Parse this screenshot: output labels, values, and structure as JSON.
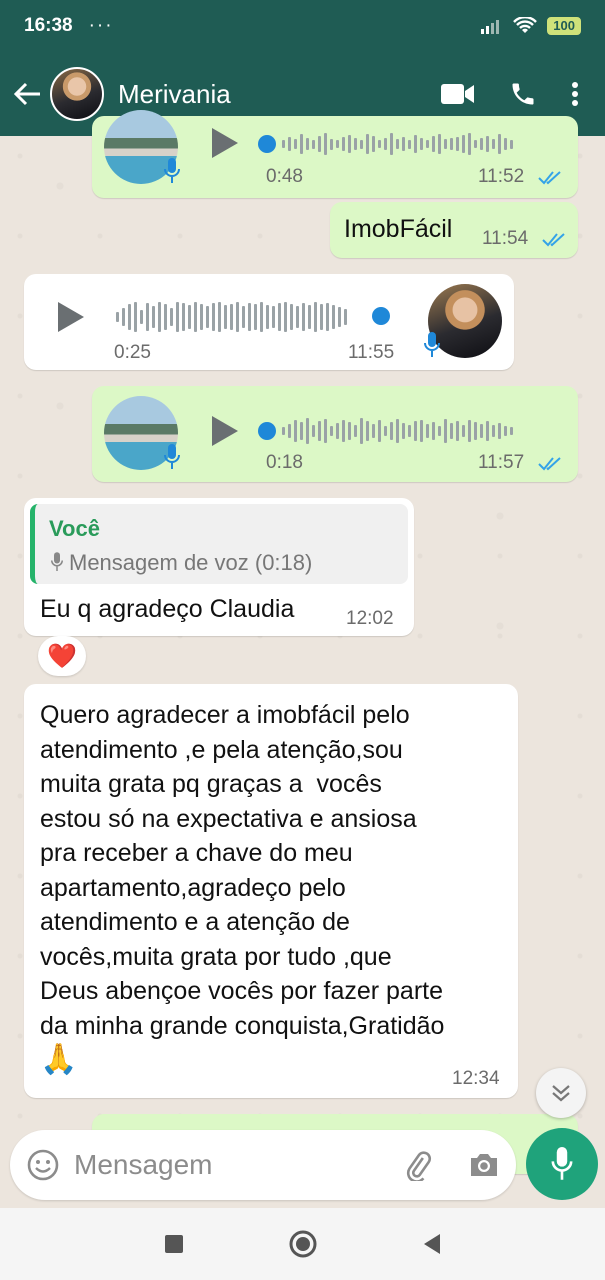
{
  "status_bar": {
    "time": "16:38",
    "dots": "···",
    "battery": "100"
  },
  "header": {
    "contact_name": "Merivania"
  },
  "messages": [
    {
      "id": "voice-out-1",
      "duration": "0:48",
      "time": "11:52"
    },
    {
      "id": "text-out-1",
      "text": "ImobFácil",
      "time": "11:54"
    },
    {
      "id": "voice-in-1",
      "duration": "0:25",
      "time": "11:55"
    },
    {
      "id": "voice-out-2",
      "duration": "0:18",
      "time": "11:57"
    },
    {
      "id": "reply-in-1",
      "quote_author": "Você",
      "quote_text": "Mensagem de voz (0:18)",
      "text": "Eu q agradeço Claudia",
      "time": "12:02",
      "reaction": "❤️"
    },
    {
      "id": "text-in-2",
      "lines": [
        "Quero agradecer a imobfácil pelo",
        "atendimento ,e pela atenção,sou",
        "muita grata pq graças a  vocês",
        "estou só na expectativa e ansiosa",
        "pra receber a chave do meu",
        "apartamento,agradeço pelo",
        "atendimento e a atenção de",
        "vocês,muita grata por tudo ,que",
        "Deus abençoe vocês por fazer parte",
        "da minha grande conquista,Gratidão",
        "🙏"
      ],
      "time": "12:34"
    }
  ],
  "input": {
    "placeholder": "Mensagem"
  },
  "colors": {
    "header": "#1f5c54",
    "outgoing": "#dcf8c6",
    "incoming": "#ffffff",
    "accent": "#1fa37b",
    "tick_blue": "#34a3e8"
  },
  "icons": [
    "back-arrow-icon",
    "video-call-icon",
    "phone-icon",
    "more-vert-icon",
    "play-icon",
    "mic-icon",
    "check-double-icon",
    "emoji-icon",
    "attach-icon",
    "camera-icon",
    "chevron-down-icon"
  ]
}
